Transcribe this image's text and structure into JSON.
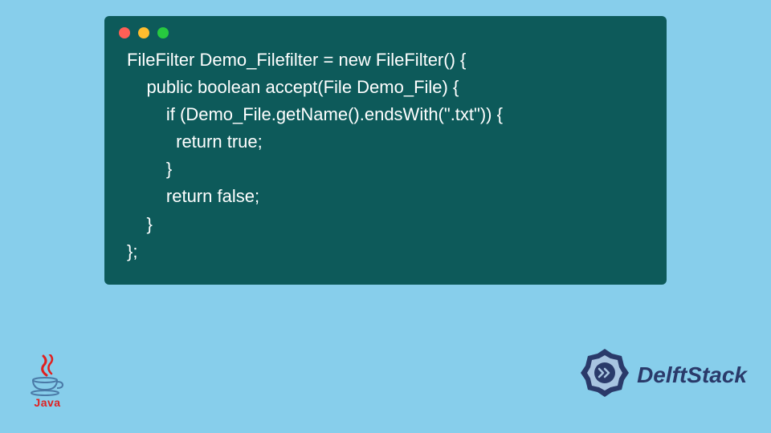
{
  "code": {
    "lines": [
      "FileFilter Demo_Filefilter = new FileFilter() {",
      "    public boolean accept(File Demo_File) {",
      "        if (Demo_File.getName().endsWith(\".txt\")) {",
      "          return true;",
      "        }",
      "        return false;",
      "    }",
      "};"
    ]
  },
  "window": {
    "dot_red": "close",
    "dot_yellow": "minimize",
    "dot_green": "maximize"
  },
  "logos": {
    "java_text": "Java",
    "delftstack_text": "DelftStack"
  },
  "colors": {
    "page_bg": "#87ceeb",
    "window_bg": "#0d5a5a",
    "code_color": "#ffffff",
    "delftstack_color": "#2a3a6a",
    "java_red": "#e02020",
    "java_blue": "#4a7aa7"
  }
}
